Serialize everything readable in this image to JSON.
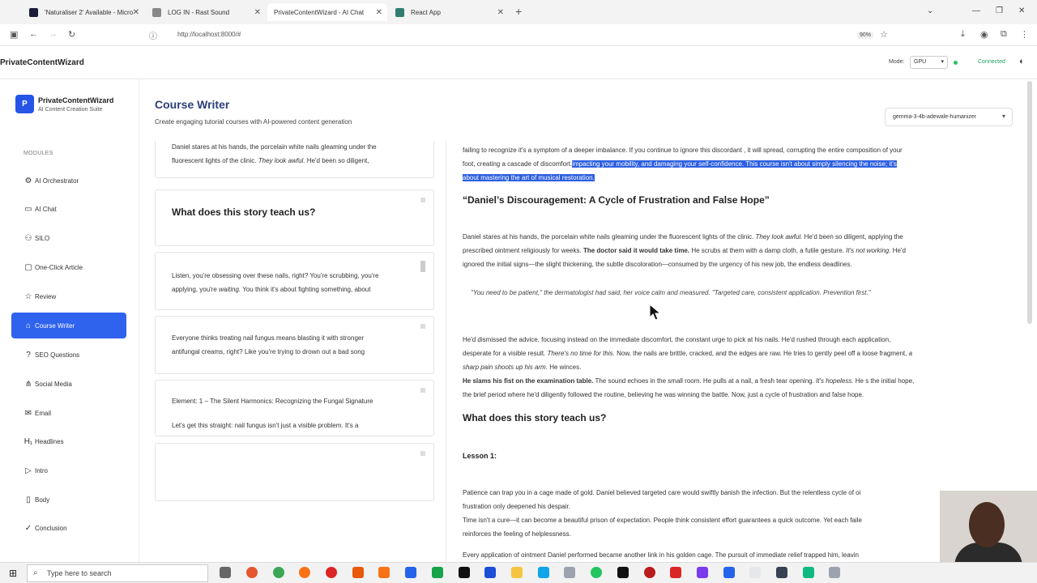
{
  "browser": {
    "tabs": [
      {
        "title": "'Naturaliser 2' Available - Micro",
        "color": "#1b1b3a"
      },
      {
        "title": "LOG IN - Rast Sound",
        "color": "#888888"
      },
      {
        "title": "PrivateContentWizard - AI Chat",
        "color": "#ffffff"
      },
      {
        "title": "React App",
        "color": "#2f7d6d"
      }
    ],
    "url": "http://localhost:8000/#",
    "zoom": "90%"
  },
  "app": {
    "title": "PrivateContentWizard",
    "mode_label": "Mode:",
    "mode_value": "GPU",
    "status": "Connected"
  },
  "sidebar": {
    "brand_logo": "P",
    "brand_name": "PrivateContentWizard",
    "brand_sub": "AI Content Creation Suite",
    "modules_label": "MODULES",
    "items": [
      {
        "label": "AI Orchestrator",
        "icon": "orchestrator-icon",
        "glyph": "⚙"
      },
      {
        "label": "AI Chat",
        "icon": "chat-icon",
        "glyph": "▭"
      },
      {
        "label": "SILO",
        "icon": "silo-icon",
        "glyph": "⚇"
      },
      {
        "label": "One-Click Article",
        "icon": "article-icon",
        "glyph": "▢"
      },
      {
        "label": "Review",
        "icon": "star-icon",
        "glyph": "☆"
      },
      {
        "label": "Course Writer",
        "icon": "graduation-icon",
        "glyph": "⌂"
      },
      {
        "label": "SEO Questions",
        "icon": "help-icon",
        "glyph": "?"
      },
      {
        "label": "Social Media",
        "icon": "share-icon",
        "glyph": "⋔"
      },
      {
        "label": "Email",
        "icon": "mail-icon",
        "glyph": "✉"
      },
      {
        "label": "Headlines",
        "icon": "heading-icon",
        "glyph": "H₁"
      },
      {
        "label": "Intro",
        "icon": "play-icon",
        "glyph": "▷"
      },
      {
        "label": "Body",
        "icon": "file-icon",
        "glyph": "▯"
      },
      {
        "label": "Conclusion",
        "icon": "check-circle-icon",
        "glyph": "✓"
      }
    ]
  },
  "main": {
    "title": "Course Writer",
    "subtitle": "Create engaging tutorial courses with AI-powered content generation",
    "model": "gemma-3-4b-adewale-humanizer"
  },
  "left_cards": {
    "card1_text1": "Daniel stares at his hands, the porcelain white nails gleaming under the",
    "card1_text2a": "fluorescent lights of the clinic.",
    "card1_text2b": "They look awful.",
    "card1_text2c": "He'd been so diligent,",
    "card2_title": "What does this story teach us?",
    "card3_text1": "Listen, you're obsessing over these nails, right? You're scrubbing, you're",
    "card3_text2a": "applying, you're",
    "card3_text2b": "waiting.",
    "card3_text2c": "You think it's about fighting something, about",
    "card4_text1": "Everyone thinks treating nail fungus means blasting it with stronger",
    "card4_text2": "antifungal creams, right? Like you're trying to drown out a bad song",
    "card5_title": "Element: 1 – The Silent Harmonics: Recognizing the Fungal Signature",
    "card5_text": "Let's get this straight: nail fungus isn't just a visible problem. It's a"
  },
  "right_panel": {
    "p1_line1": "failing to recognize it's a symptom of a deeper imbalance. If you continue to ignore this discordant , it will spread, corrupting the entire composition of your",
    "p1_line2_plain": "foot, creating a cascade of discomfort.",
    "p1_line2_hl": "impacting your mobility, and damaging your self-confidence. This course isn't about simply silencing the noise; it's",
    "p1_line3_hl": "about mastering the art of musical restoration.",
    "h_story": "“Daniel’s Discouragement: A Cycle of Frustration and False Hope”",
    "p2_l1a": "Daniel stares at his hands, the porcelain white nails gleaming under the fluorescent lights of the clinic.",
    "p2_l1b": "They look awful.",
    "p2_l1c": "He'd been so diligent, applying the",
    "p2_l2a": "prescribed ointment religiously for weeks.",
    "p2_l2b": "The doctor said it would take time.",
    "p2_l2c": "He scrubs at them with a damp cloth, a futile gesture.",
    "p2_l2d": "It's not working.",
    "p2_l2e": "He'd",
    "p2_l3": "ignored the initial  signs—the slight thickening, the subtle discoloration—consumed by the urgency of his new job, the endless deadlines.",
    "quote": "\"You need to be patient,\" the dermatologist had said, her voice calm and measured. \"Targeted care, consistent application. Prevention first.\"",
    "p3_l1": "He'd dismissed the advice, focusing instead on the immediate discomfort, the constant urge to pick at his nails. He'd rushed through each application,",
    "p3_l2a": "desperate for a visible result.",
    "p3_l2b": "There's no time for this.",
    "p3_l2c": "Now, the nails are brittle, cracked, and the edges are raw. He tries to gently peel off a loose fragment,",
    "p3_l2d": "a",
    "p3_l3a": "sharp pain shoots up his arm.",
    "p3_l3b": "He winces.",
    "p3_l4a": "He slams his fist on the examination table.",
    "p3_l4b": "The sound echoes in the small room. He pulls at a nail, a fresh tear opening.",
    "p3_l4c": "It's hopeless.",
    "p3_l4d": "He s the initial hope,",
    "p3_l5": "the brief period where he'd diligently followed the routine, believing he was winning the battle. Now, just a cycle of frustration and false hope.",
    "h_teach": "What does this story teach us?",
    "h_lesson": "Lesson 1:",
    "p4_l1": "Patience can trap you in a cage made of gold. Daniel believed targeted care would swiftly banish the infection. But the relentless cycle of oi",
    "p4_l2": "frustration only deepened his despair.",
    "p4_l3": "Time isn't a cure—it can become a beautiful prison of expectation. People think consistent effort guarantees a quick outcome. Yet each faile",
    "p4_l4": "reinforces the feeling of helplessness.",
    "p5_l1": "Every application of ointment Daniel performed became another link in his golden cage. The pursuit of immediate relief trapped him, leavin"
  },
  "taskbar": {
    "search_placeholder": "Type here to search"
  }
}
